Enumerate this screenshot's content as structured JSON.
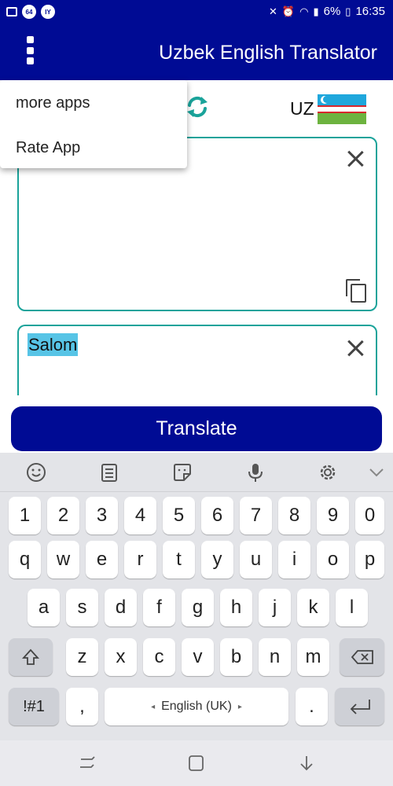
{
  "status_bar": {
    "left_badges": [
      "64",
      "IY"
    ],
    "battery": "6%",
    "time": "16:35"
  },
  "app_bar": {
    "title": "Uzbek English Translator",
    "menu_icon": "more-vert-icon"
  },
  "menu": {
    "items": [
      "more apps",
      "Rate App"
    ]
  },
  "language": {
    "code": "UZ",
    "swap_icon": "swap-refresh-icon",
    "flag": "uzbekistan-flag"
  },
  "input": {
    "value": "Salom"
  },
  "translate_label": "Translate",
  "keyboard": {
    "toolbar_icons": [
      "emoji-icon",
      "clipboard-icon",
      "sticker-icon",
      "mic-icon",
      "settings-icon",
      "chevron-down-icon"
    ],
    "row_numbers": [
      "1",
      "2",
      "3",
      "4",
      "5",
      "6",
      "7",
      "8",
      "9",
      "0"
    ],
    "row_1": [
      "q",
      "w",
      "e",
      "r",
      "t",
      "y",
      "u",
      "i",
      "o",
      "p"
    ],
    "row_2": [
      "a",
      "s",
      "d",
      "f",
      "g",
      "h",
      "j",
      "k",
      "l"
    ],
    "row_3": [
      "z",
      "x",
      "c",
      "v",
      "b",
      "n",
      "m"
    ],
    "symbols_key": "!#1",
    "comma_key": ",",
    "space_label": "English (UK)",
    "period_key": "."
  },
  "colors": {
    "brand": "#000b94",
    "accent": "#1aa39a",
    "selection": "#57c4e6"
  }
}
